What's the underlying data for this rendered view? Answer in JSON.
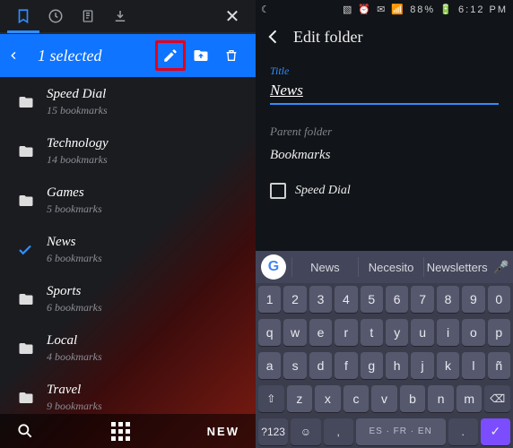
{
  "left": {
    "selection_label": "1 selected",
    "folders": [
      {
        "name": "Speed Dial",
        "meta": "15 bookmarks",
        "selected": false
      },
      {
        "name": "Technology",
        "meta": "14 bookmarks",
        "selected": false
      },
      {
        "name": "Games",
        "meta": "5 bookmarks",
        "selected": false
      },
      {
        "name": "News",
        "meta": "6 bookmarks",
        "selected": true
      },
      {
        "name": "Sports",
        "meta": "6 bookmarks",
        "selected": false
      },
      {
        "name": "Local",
        "meta": "4 bookmarks",
        "selected": false
      },
      {
        "name": "Travel",
        "meta": "9 bookmarks",
        "selected": false
      }
    ],
    "new_label": "NEW"
  },
  "right": {
    "status": {
      "battery": "88%",
      "time": "6:12 PM"
    },
    "header": "Edit folder",
    "title_label": "Title",
    "title_value": "News",
    "parent_label": "Parent folder",
    "parent_value": "Bookmarks",
    "speed_dial_label": "Speed Dial",
    "suggestions": [
      "News",
      "Necesito",
      "Newsletters"
    ],
    "space_label": "ES · FR · EN",
    "rows": {
      "r1": [
        "1",
        "2",
        "3",
        "4",
        "5",
        "6",
        "7",
        "8",
        "9",
        "0"
      ],
      "r2": [
        "q",
        "w",
        "e",
        "r",
        "t",
        "y",
        "u",
        "i",
        "o",
        "p"
      ],
      "r3": [
        "a",
        "s",
        "d",
        "f",
        "g",
        "h",
        "j",
        "k",
        "l",
        "ñ"
      ],
      "r4": [
        "⇧",
        "z",
        "x",
        "c",
        "v",
        "b",
        "n",
        "m",
        "⌫"
      ],
      "r5": [
        "?123",
        "☺",
        ",",
        "SPACE",
        ".",
        "✓"
      ]
    }
  }
}
